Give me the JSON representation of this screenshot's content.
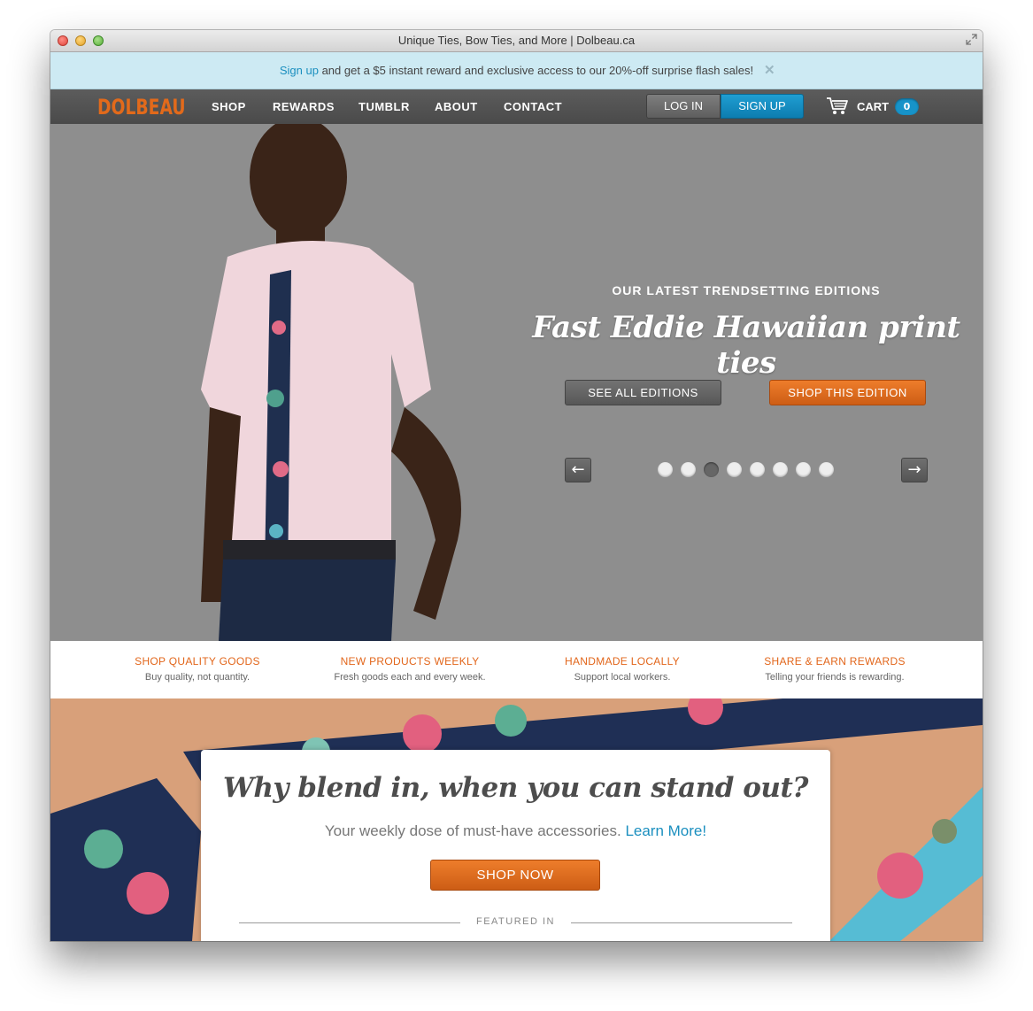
{
  "window": {
    "title": "Unique Ties, Bow Ties, and More | Dolbeau.ca"
  },
  "promo": {
    "link_text": "Sign up",
    "text": " and get a $5 instant reward and exclusive access to our 20%-off surprise flash sales!",
    "close": "✕"
  },
  "nav": {
    "logo": "DOLBEAU",
    "items": [
      "SHOP",
      "REWARDS",
      "TUMBLR",
      "ABOUT",
      "CONTACT"
    ],
    "login": "LOG IN",
    "signup": "SIGN UP",
    "cart_label": "CART",
    "cart_count": "0"
  },
  "hero": {
    "eyebrow": "OUR LATEST TRENDSETTING EDITIONS",
    "title": "Fast Eddie Hawaiian print ties",
    "see_all": "SEE ALL EDITIONS",
    "shop_edition": "SHOP THIS EDITION",
    "prev": "←",
    "next": "→",
    "slide_count": 8,
    "active_slide": 3
  },
  "features": [
    {
      "title": "SHOP QUALITY GOODS",
      "subtitle": "Buy quality, not quantity."
    },
    {
      "title": "NEW PRODUCTS WEEKLY",
      "subtitle": "Fresh goods each and every week."
    },
    {
      "title": "HANDMADE LOCALLY",
      "subtitle": "Support local workers."
    },
    {
      "title": "SHARE & EARN REWARDS",
      "subtitle": "Telling your friends is rewarding."
    }
  ],
  "banner": {
    "title": "Why blend in, when you can stand out?",
    "subtitle": "Your weekly dose of must-have accessories.",
    "learn_more": "Learn More!",
    "shop_now": "SHOP NOW",
    "featured_in": "FEATURED IN"
  },
  "colors": {
    "accent_orange": "#e2661b",
    "link_blue": "#1b8fbf",
    "nav_bg": "#555555",
    "hero_bg": "#8e8e8e",
    "promo_bg": "#cdeaf3"
  }
}
